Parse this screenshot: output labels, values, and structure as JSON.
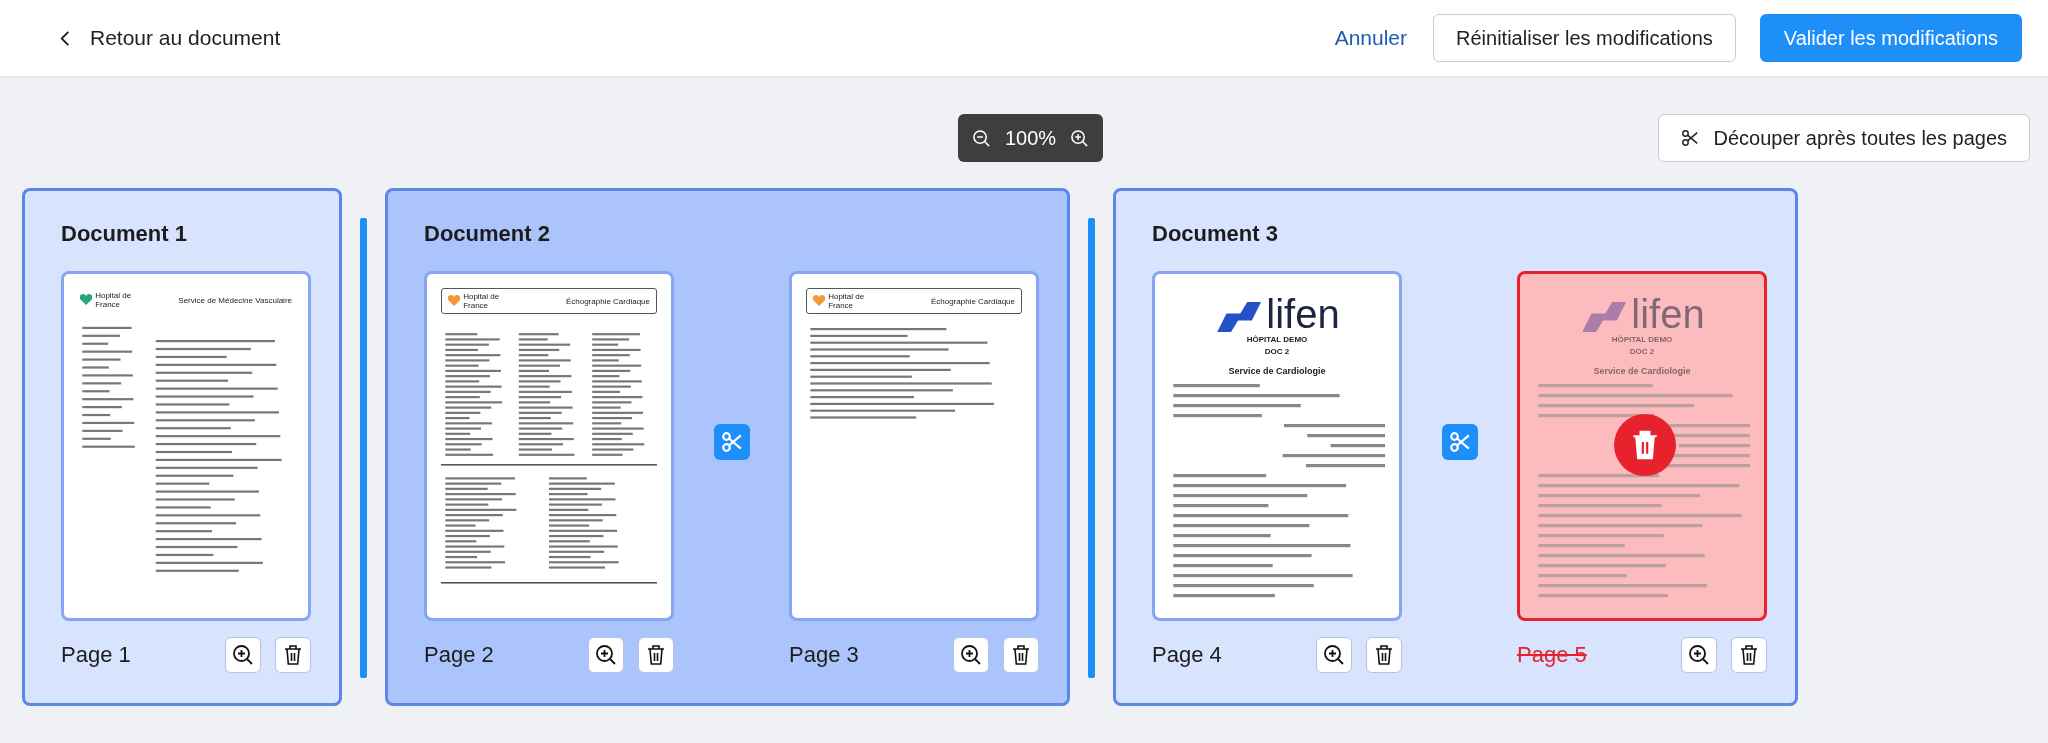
{
  "header": {
    "back_label": "Retour au document",
    "cancel": "Annuler",
    "reset": "Réinitialiser les modifications",
    "validate": "Valider les modifications"
  },
  "zoom": {
    "value": "100%"
  },
  "split_all": {
    "label": "Découper après toutes les pages"
  },
  "documents": [
    {
      "title": "Document 1",
      "selected": false,
      "pages": [
        {
          "label": "Page 1",
          "deleted": false,
          "thumbnail": {
            "kind": "letter",
            "logo": "Hopital de France",
            "heading": "Service de Médecine Vasculaire"
          }
        }
      ]
    },
    {
      "title": "Document 2",
      "selected": true,
      "pages": [
        {
          "label": "Page 2",
          "deleted": false,
          "thumbnail": {
            "kind": "report",
            "logo": "Hopital de France",
            "heading": "Échographie Cardiaque"
          }
        },
        {
          "label": "Page 3",
          "deleted": false,
          "thumbnail": {
            "kind": "report",
            "logo": "Hopital de France",
            "heading": "Échographie Cardiaque"
          }
        }
      ]
    },
    {
      "title": "Document 3",
      "selected": false,
      "pages": [
        {
          "label": "Page 4",
          "deleted": false,
          "thumbnail": {
            "kind": "lifen",
            "logo": "lifen",
            "heading": "HÔPITAL DEMO",
            "subheading": "DOC 2",
            "service": "Service de Cardiologie"
          }
        },
        {
          "label": "Page 5",
          "deleted": true,
          "thumbnail": {
            "kind": "lifen",
            "logo": "lifen",
            "heading": "HÔPITAL DEMO",
            "subheading": "DOC 2",
            "service": "Service de Cardiologie"
          }
        }
      ]
    }
  ]
}
